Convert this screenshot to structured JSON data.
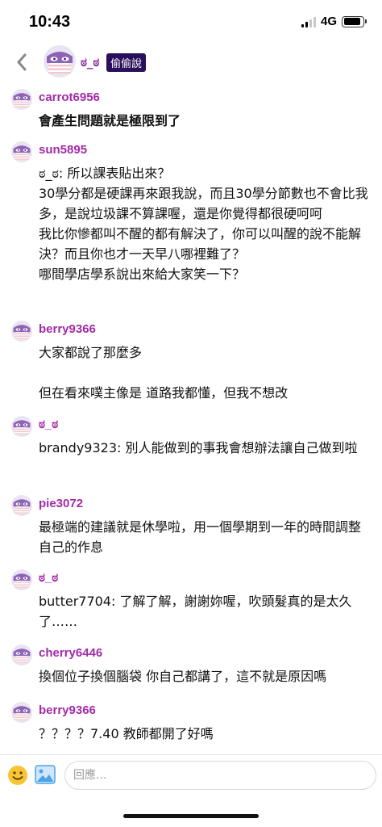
{
  "status_bar": {
    "time": "10:43",
    "network": "4G",
    "signal_bars_filled": 2,
    "signal_bars_total": 4,
    "battery_level": 0.9
  },
  "header": {
    "back_icon": "chevron-left-icon",
    "name": "ಠ_ಠ",
    "badge": "偷偷說"
  },
  "comments": [
    {
      "user": "carrot6956",
      "text": "會產生問題就是極限到了",
      "bold": true
    },
    {
      "user": "sun5895",
      "text": "ಠ_ಠ: 所以課表貼出來？\n30學分都是硬課再來跟我說，而且30學分節數也不會比我多，是說垃圾課不算課喔，還是你覺得都很硬呵呵\n我比你慘都叫不醒的都有解決了，你可以叫醒的說不能解決？而且你也才一天早八哪裡難了？\n哪間學店學系說出來給大家笑一下？",
      "bold": false
    },
    {
      "user": "berry9366",
      "text": "大家都說了那麼多\n\n但在看來噗主像是 道路我都懂，但我不想改",
      "bold": false
    },
    {
      "user": "ಠ_ಠ",
      "text": "brandy9323: 別人能做到的事我會想辦法讓自己做到啦",
      "bold": false
    },
    {
      "user": "pie3072",
      "text": "最極端的建議就是休學啦，用一個學期到一年的時間調整自己的作息",
      "bold": false
    },
    {
      "user": "ಠ_ಠ",
      "text": "butter7704: 了解了解，謝謝妳喔，吹頭髮真的是太久了……",
      "bold": false
    },
    {
      "user": "cherry6446",
      "text": "換個位子換個腦袋 你自己都講了，這不就是原因嗎",
      "bold": false
    },
    {
      "user": "berry9366",
      "text": "？？？？7.40 教師都開了好嗎",
      "bold": false
    }
  ],
  "input_bar": {
    "placeholder": "回應...",
    "emoji_icon": "smiley-icon",
    "image_icon": "image-icon"
  },
  "colors": {
    "username": "#a32aa8",
    "badge_bg": "#2a0f5a",
    "avatar_purple": "#8e62b6",
    "avatar_stripe": "#f3c6cf"
  }
}
